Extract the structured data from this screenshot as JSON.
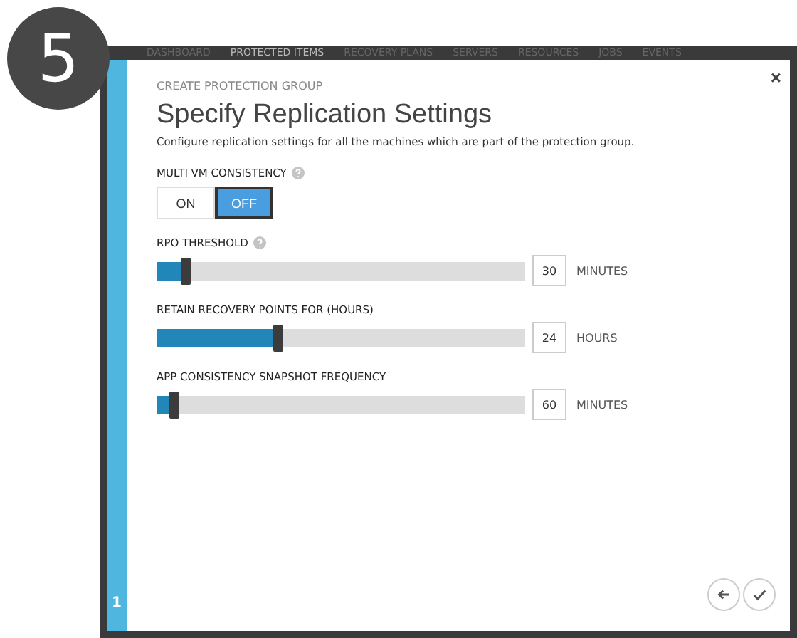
{
  "step_badge": "5",
  "nav": [
    {
      "label": "DASHBOARD",
      "selected": false
    },
    {
      "label": "PROTECTED ITEMS",
      "selected": true
    },
    {
      "label": "RECOVERY PLANS",
      "selected": false
    },
    {
      "label": "SERVERS",
      "selected": false
    },
    {
      "label": "RESOURCES",
      "selected": false
    },
    {
      "label": "JOBS",
      "selected": false
    },
    {
      "label": "EVENTS",
      "selected": false
    }
  ],
  "dialog": {
    "close": "×",
    "breadcrumb": "CREATE PROTECTION GROUP",
    "title": "Specify Replication Settings",
    "description": "Configure replication settings for all the machines which are part of the protection group.",
    "step": "1",
    "consistency": {
      "label": "MULTI VM CONSISTENCY",
      "help": true,
      "options": [
        {
          "label": "ON",
          "selected": false
        },
        {
          "label": "OFF",
          "selected": true
        }
      ]
    },
    "sliders": [
      {
        "label": "RPO THRESHOLD",
        "help": true,
        "level": 0.07,
        "value": "30",
        "unit": "MINUTES"
      },
      {
        "label": "RETAIN RECOVERY POINTS FOR (HOURS)",
        "help": false,
        "level": 0.32,
        "value": "24",
        "unit": "HOURS"
      },
      {
        "label": "APP CONSISTENCY SNAPSHOT FREQUENCY",
        "help": false,
        "level": 0.04,
        "value": "60",
        "unit": "MINUTES"
      }
    ]
  }
}
